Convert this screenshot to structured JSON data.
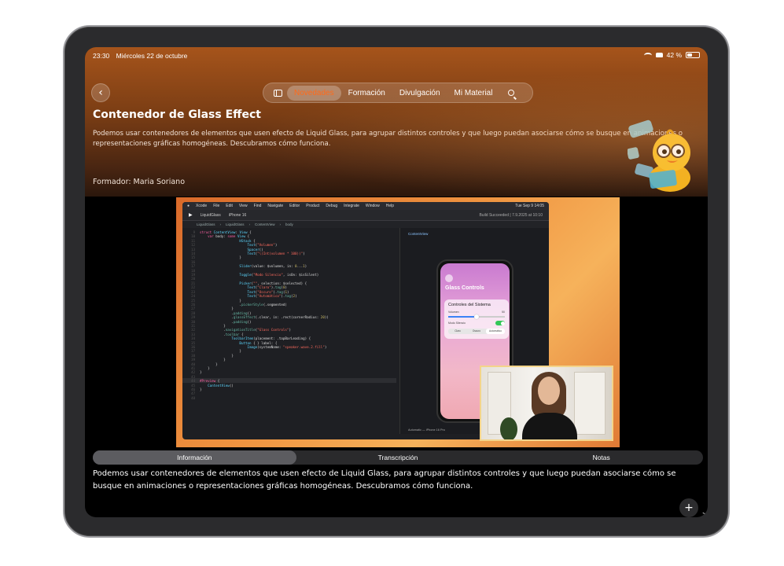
{
  "status_bar": {
    "time": "23:30",
    "date": "Miércoles 22 de octubre",
    "battery": "42 %",
    "battery_level": 0.42
  },
  "nav": {
    "tabs": [
      {
        "label": "Novedades",
        "active": true
      },
      {
        "label": "Formación",
        "active": false
      },
      {
        "label": "Divulgación",
        "active": false
      },
      {
        "label": "Mi Material",
        "active": false
      }
    ],
    "accent_color": "#ff6a1a"
  },
  "hero": {
    "title": "Contenedor de Glass Effect",
    "description": "Podemos usar contenedores de elementos que usen efecto de Liquid Glass, para agrupar distintos controles y que luego puedan asociarse cómo se busque en animaciones o representaciones gráficas homogéneas. Descubramos cómo funciona.",
    "trainer": "Formador: Maria Soriano"
  },
  "video": {
    "menubar": {
      "app": "Xcode",
      "items": [
        "File",
        "Edit",
        "View",
        "Find",
        "Navigate",
        "Editor",
        "Product",
        "Debug",
        "Integrate",
        "Window",
        "Help"
      ],
      "clock": "Tue Sep 9 14:05"
    },
    "toolbar": {
      "project": "LiquidGlass",
      "device": "iPhone 16",
      "status": "Build Succeeded | 7.9.2025 at 10:10"
    },
    "breadcrumb": [
      "LiquidGlass",
      "LiquidGlass",
      "ContentView",
      "body"
    ],
    "preview_label": "ContentView",
    "preview_footer": "Automatic — iPhone 16 Pro",
    "phone": {
      "title": "Glass Controls",
      "card_title": "Controles del Sistema",
      "volume_label": "Volumen",
      "volume_value": "50",
      "volume_level": 0.5,
      "silent_label": "Modo Silencio",
      "silent_on": true,
      "segments": [
        "Claro",
        "Oscuro",
        "Automático"
      ],
      "selected_segment": 2
    }
  },
  "tabs": [
    {
      "label": "Información",
      "active": true
    },
    {
      "label": "Transcripción",
      "active": false
    },
    {
      "label": "Notas",
      "active": false
    }
  ],
  "info_text": "Podemos usar contenedores de elementos que usen efecto de Liquid Glass, para agrupar distintos controles y que luego puedan asociarse cómo se busque en animaciones o representaciones gráficas homogéneas. Descubramos cómo funciona.",
  "fab_label": "+"
}
